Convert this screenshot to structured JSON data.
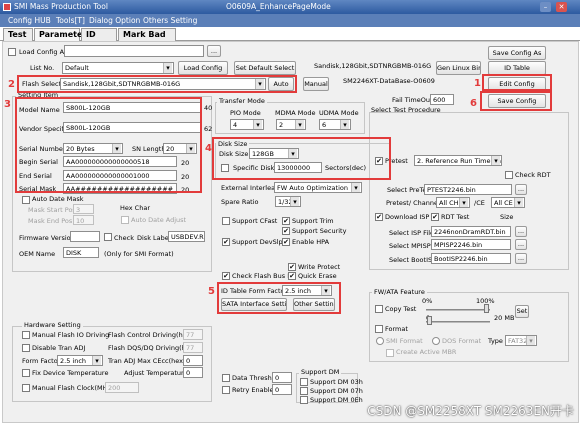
{
  "window": {
    "title": "SMI Mass Production Tool",
    "subtitle": "O0609A_EnhancePageMode",
    "icon": "app-icon"
  },
  "menu": [
    "Config HUB",
    "Tools[T]",
    "Dialog Option",
    "Others Setting"
  ],
  "tabs": [
    "Test",
    "Parameter",
    "ID Table",
    "Mark Bad Info"
  ],
  "top": {
    "load_config_as_label": "Load Config As",
    "dots": "...",
    "list_no_label": "List No.",
    "list_no_value": "Default",
    "load_config": "Load Config",
    "set_default_select": "Set Default Select",
    "info_text": "Sandisk,128Gbit,SDTNRGBMB-016G",
    "gen_linux_bin": "Gen Linux Bin",
    "save_config_as": "Save Config As",
    "id_table": "ID Table",
    "flash_select_label": "Flash Select",
    "flash_select_value": "Sandisk,128Gbit,SDTNRGBMB-016G",
    "auto": "Auto",
    "manual": "Manual",
    "database": "SM2246XT-DataBase-O0609",
    "edit_config": "Edit Config",
    "fail_timeout_label": "Fail TimeOut",
    "fail_timeout_value": "600",
    "save_config": "Save Config",
    "select_test_procedure": "Select Test Procedure"
  },
  "setting_item": {
    "title": "Setting Item",
    "model_name_label": "Model Name",
    "model_name_value": "S800L-120GB",
    "model_name_len": "40",
    "vendor_specific_label": "Vendor Specific",
    "vendor_specific_value": "S800L-120GB",
    "vendor_specific_len": "62",
    "serial_number_label": "Serial Number",
    "serial_number_value": "20 Bytes",
    "sn_length_label": "SN Length",
    "sn_length_value": "20",
    "begin_serial_label": "Begin Serial",
    "begin_serial_value": "AA000000000000000518",
    "begin_serial_len": "20",
    "end_serial_label": "End Serial",
    "end_serial_value": "AA000000000000001000",
    "end_serial_len": "20",
    "serial_mask_label": "Serial Mask",
    "serial_mask_value": "AA##################",
    "serial_mask_len": "20",
    "auto_date_mask": "Auto Date Mask",
    "mask_start_pos_label": "Mask Start Pos",
    "mask_start_pos_value": "3",
    "mask_end_pos_label": "Mask End Pos",
    "mask_end_pos_value": "10",
    "hex_char_label": "Hex Char",
    "auto_date_adjust": "Auto Date Adjust",
    "firmware_version_label": "Firmware Version",
    "check_label": "Check",
    "disk_label_label": "Disk Label",
    "disk_label_value": "USBDEV.RU",
    "oem_name_label": "OEM Name",
    "oem_name_value": "DISK",
    "oem_name_note": "(Only for SMI Format)"
  },
  "transfer_mode": {
    "title": "Transfer Mode",
    "pio_label": "PIO Mode",
    "pio_value": "4",
    "mdma_label": "MDMA Mode",
    "mdma_value": "2",
    "udma_label": "UDMA Mode",
    "udma_value": "6"
  },
  "disk_size": {
    "title": "Disk Size",
    "label": "Disk Size",
    "value": "128GB",
    "specific_label": "Specific Disk Size",
    "specific_value": "13000000",
    "sectors_label": "Sectors(dec)"
  },
  "options": {
    "external_interleave_label": "External Interleave",
    "external_interleave_value": "FW Auto Optimization",
    "spare_ratio_label": "Spare Ratio",
    "spare_ratio_value": "1/32",
    "support_cfast": "Support CFast",
    "support_trim": "Support Trim",
    "support_security": "Support Security",
    "support_devslp": "Support DevSlp",
    "enable_hpa": "Enable HPA",
    "write_protect": "Write Protect",
    "check_flash_bus_bit": "Check Flash Bus Bit",
    "quick_erase": "Quick Erase",
    "id_table_form_factor_label": "ID Table Form Factor",
    "id_table_form_factor_value": "2.5 inch",
    "sata_interface_setting": "SATA Interface Setting",
    "other_setting": "Other Setting",
    "data_threshold_label": "Data Threshold",
    "data_threshold_value": "0",
    "retry_enable_label": "Retry Enable",
    "retry_enable_value": "0",
    "support_dm_title": "Support DM",
    "support_dm_03h": "Support DM 03h",
    "support_dm_07h": "Support DM 07h",
    "support_dm_0eh": "Support DM 0Eh"
  },
  "test_procedure": {
    "pretest_label": "Pretest",
    "pretest_value": "2. Reference Run Time Bad",
    "check_rdt": "Check RDT",
    "select_pretest_label": "Select PreTest",
    "select_pretest_value": "PTEST2246.bin",
    "pretest_channel_label": "Pretest/ Channel",
    "channel_a": "All CH",
    "ce_label": "/CE",
    "channel_b": "All CE",
    "download_isp": "Download ISP",
    "rdt_test": "RDT Test",
    "size_label": "Size",
    "select_isp_file_label": "Select ISP File",
    "select_isp_file_value": "2246nonDramRDT.bin",
    "select_mpisp_label": "Select MPISP",
    "select_mpisp_value": "MPISP2246.bin",
    "select_bootisp_label": "Select BootISP",
    "select_bootisp_value": "BootISP2246.bin"
  },
  "fw_ata": {
    "title": "FW/ATA Feature",
    "copy_test": "Copy Test",
    "pct_0": "0%",
    "pct_100": "100%",
    "val_0": "0",
    "val_20": "20 MB",
    "set": "Set",
    "format": "Format",
    "smi_format": "SMI Format",
    "dos_format": "DOS Format",
    "type_label": "Type",
    "type_value": "FAT32",
    "create_active_mbr": "Create Active MBR"
  },
  "hardware": {
    "title": "Hardware Setting",
    "manual_flash_io_driving": "Manual Flash IO Driving",
    "flash_control_driving_label": "Flash Control Driving(hex)",
    "flash_control_driving_value": "77",
    "disable_tran_adj": "Disable Tran ADJ",
    "flash_dqs_label": "Flash DQS/DQ Driving(hex)",
    "flash_dqs_value": "77",
    "form_factor_label": "Form Factor",
    "form_factor_value": "2.5 inch",
    "tran_adj_label": "Tran ADJ Max CEcc(hex)",
    "tran_adj_value": "0",
    "fix_device_temp": "Fix Device Temperature",
    "adjust_temp_label": "Adjust Temperature",
    "adjust_temp_value": "0",
    "manual_flash_clock": "Manual Flash Clock(MHz)",
    "flash_clock_value": "200"
  },
  "annotations": [
    "1",
    "2",
    "3",
    "4",
    "5",
    "6"
  ],
  "watermark": "CSDN @SM2258XT SM2263EN开卡",
  "colors": {
    "title_bar": "#2d5aa0",
    "menu_bar": "#5b7fb8",
    "highlight": "#e23b3b",
    "panel": "#f0f0f0"
  }
}
